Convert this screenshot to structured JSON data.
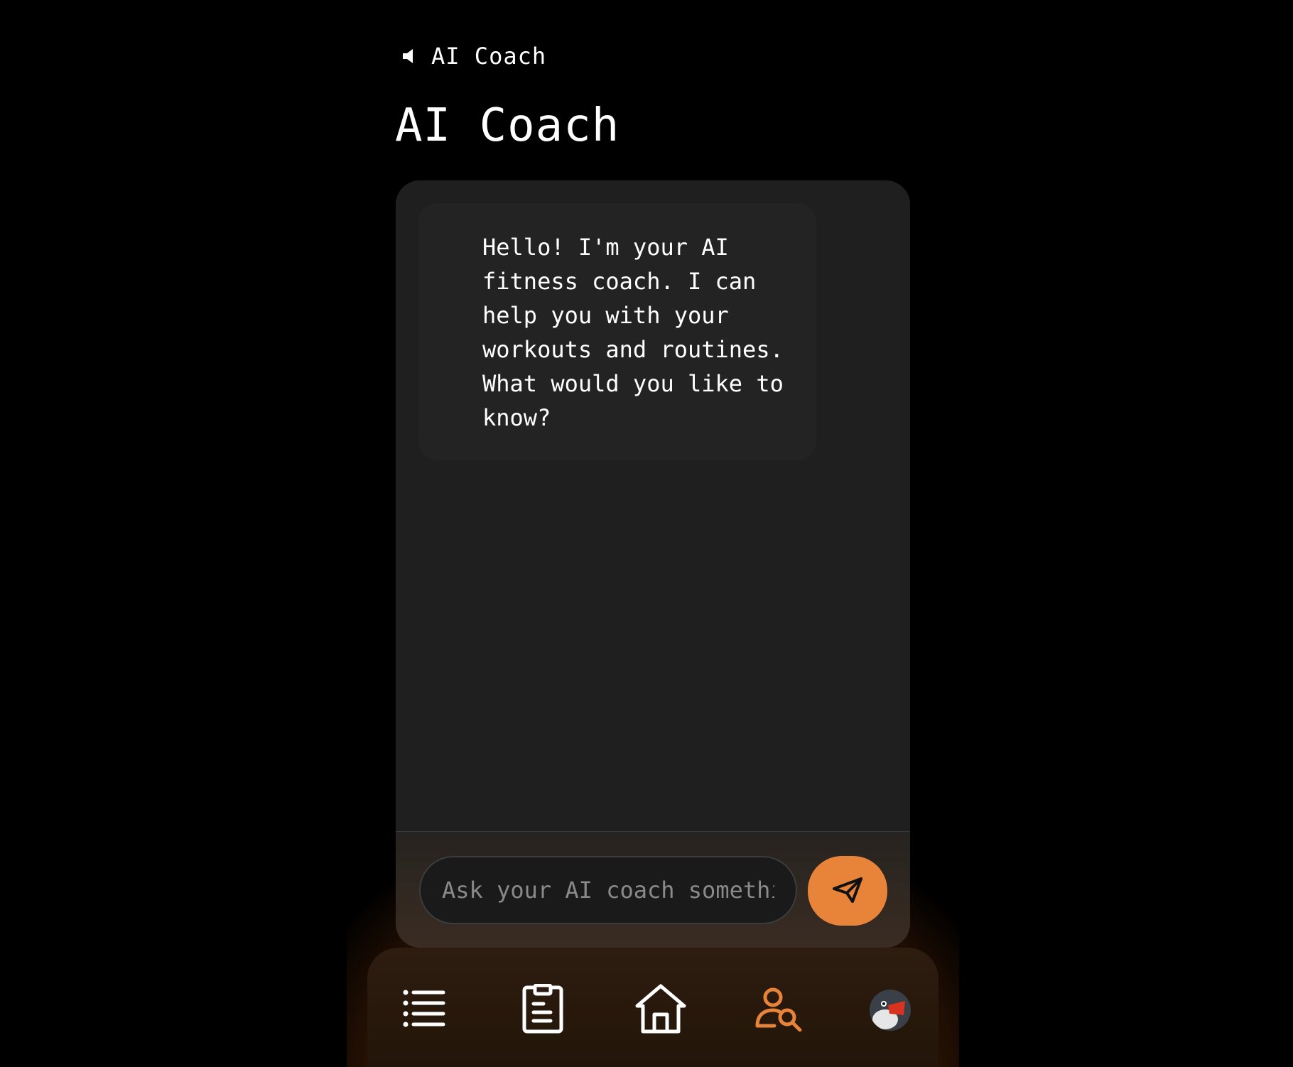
{
  "header": {
    "app_title": "AI Coach",
    "page_title": "AI Coach"
  },
  "chat": {
    "messages": [
      {
        "role": "assistant",
        "text": "Hello! I'm your AI\nfitness coach. I can\nhelp you with your\nworkouts and routines.\nWhat would you like to\nknow?"
      }
    ],
    "input_placeholder": "Ask your AI coach something...",
    "input_value": ""
  },
  "nav": {
    "items": [
      {
        "icon": "list-icon"
      },
      {
        "icon": "clipboard-icon"
      },
      {
        "icon": "home-icon"
      },
      {
        "icon": "user-search-icon",
        "active": true
      },
      {
        "icon": "avatar"
      }
    ]
  },
  "colors": {
    "accent": "#e8843a",
    "background": "#000000",
    "card": "#1f1f1f",
    "text": "#ffffff"
  }
}
